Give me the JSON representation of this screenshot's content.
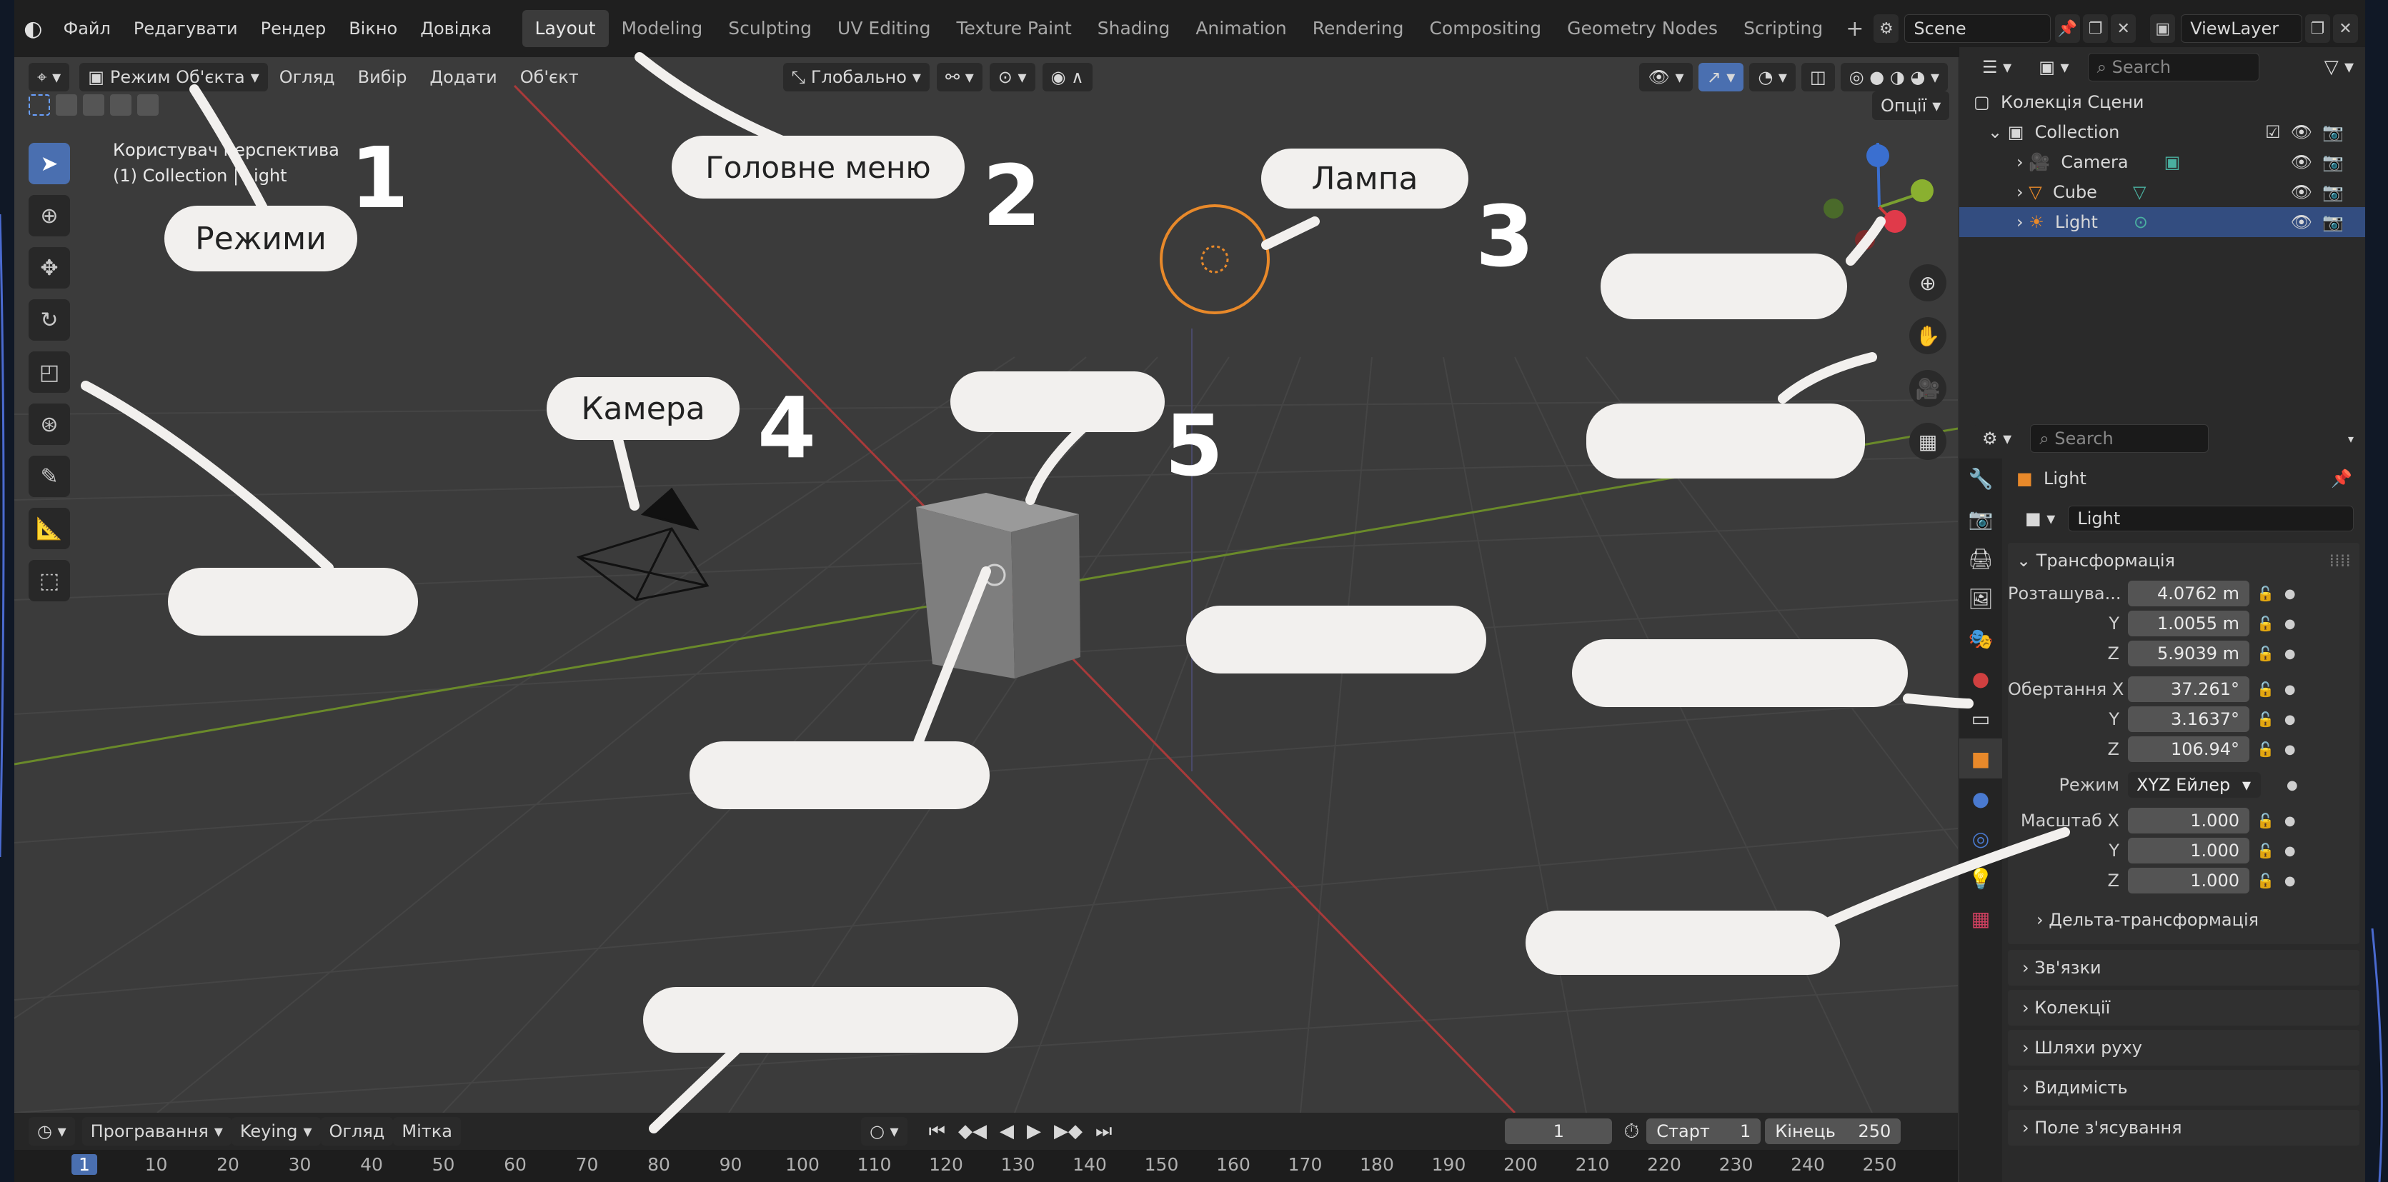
{
  "topbar": {
    "menus": [
      "Файл",
      "Редагувати",
      "Рендер",
      "Вікно",
      "Довідка"
    ],
    "workspaces": [
      "Layout",
      "Modeling",
      "Sculpting",
      "UV Editing",
      "Texture Paint",
      "Shading",
      "Animation",
      "Rendering",
      "Compositing",
      "Geometry Nodes",
      "Scripting"
    ],
    "active_workspace": "Layout",
    "scene": "Scene",
    "view_layer": "ViewLayer"
  },
  "viewport_header": {
    "mode": "Режим Об'єкта",
    "menus": [
      "Огляд",
      "Вибір",
      "Додати",
      "Об'єкт"
    ],
    "orientation": "Глобально",
    "options": "Опції"
  },
  "viewport_info": {
    "line1": "Користувач перспектива",
    "line2": "(1) Collection | Light"
  },
  "annotations": {
    "modes": "Режими",
    "main_menu": "Головне меню",
    "lamp": "Лампа",
    "camera": "Камера",
    "numbers": [
      "1",
      "2",
      "3",
      "4",
      "5"
    ]
  },
  "outliner": {
    "search_placeholder": "Search",
    "scene_collection": "Колекція Сцени",
    "collection": "Collection",
    "items": [
      "Camera",
      "Cube",
      "Light"
    ],
    "selected": "Light"
  },
  "properties": {
    "search_placeholder": "Search",
    "object_name": "Light",
    "data_name": "Light",
    "transform_title": "Трансформація",
    "location_label": "Розташува...",
    "location": [
      "4.0762 m",
      "1.0055 m",
      "5.9039 m"
    ],
    "rotation_label": "Обертання X",
    "rotation": [
      "37.261°",
      "3.1637°",
      "106.94°"
    ],
    "mode_label": "Режим",
    "rotation_mode": "XYZ Ейлер",
    "scale_label": "Масштаб X",
    "scale": [
      "1.000",
      "1.000",
      "1.000"
    ],
    "axis_y": "Y",
    "axis_z": "Z",
    "delta": "Дельта-трансформація",
    "sections": [
      "Зв'язки",
      "Колекції",
      "Шляхи руху",
      "Видимість",
      "Поле з'ясування"
    ]
  },
  "timeline": {
    "playback": "Програвання",
    "keying": "Keying",
    "view": "Огляд",
    "marker": "Мітка",
    "current_frame": "1",
    "start_label": "Старт",
    "start": "1",
    "end_label": "Кінець",
    "end": "250",
    "ruler": [
      "1",
      "10",
      "20",
      "30",
      "40",
      "50",
      "60",
      "70",
      "80",
      "90",
      "100",
      "110",
      "120",
      "130",
      "140",
      "150",
      "160",
      "170",
      "180",
      "190",
      "200",
      "210",
      "220",
      "230",
      "240",
      "250"
    ]
  },
  "colors": {
    "accent": "#4a6fb0",
    "selection": "#334d80",
    "light_orange": "#e8892a",
    "axis_red": "#a83a3a",
    "axis_green": "#6a8a2a"
  }
}
